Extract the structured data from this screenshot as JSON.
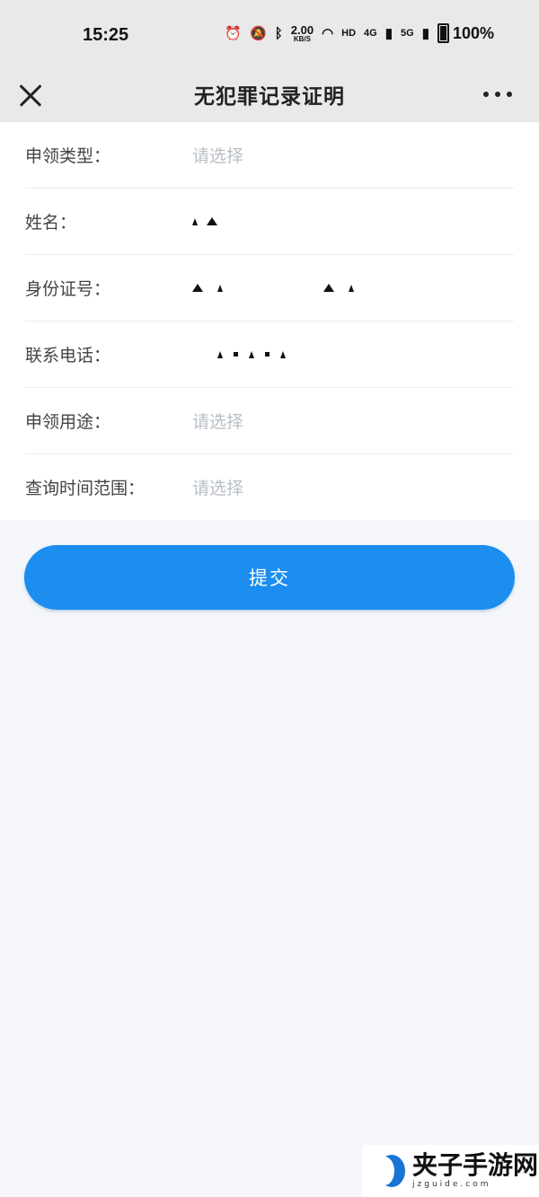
{
  "status_bar": {
    "time": "15:25",
    "net_speed_value": "2.00",
    "net_speed_unit": "KB/S",
    "hd_badge": "HD",
    "signal_1": "4G",
    "signal_2": "5G",
    "battery": "100%",
    "icons": [
      "alarm-icon",
      "mute-icon",
      "bluetooth-icon",
      "wifi-icon",
      "signal-icon",
      "battery-icon"
    ]
  },
  "navbar": {
    "title": "无犯罪记录证明",
    "close_icon": "close-icon",
    "more_icon": "more-icon"
  },
  "form": {
    "fields": [
      {
        "label": "申领类型：",
        "placeholder": "请选择"
      },
      {
        "label": "姓名："
      },
      {
        "label": "身份证号："
      },
      {
        "label": "联系电话："
      },
      {
        "label": "申领用途：",
        "placeholder": "请选择"
      },
      {
        "label": "查询时间范围：",
        "placeholder": "请选择"
      }
    ]
  },
  "submit": {
    "label": "提交"
  },
  "watermark": {
    "main": "夹子手游网",
    "sub": "jzguide.com"
  },
  "colors": {
    "primary": "#1b8ef0",
    "nav_bg": "#e9e9e9",
    "page_bg": "#f4f6f9",
    "placeholder": "#b8bec6"
  }
}
